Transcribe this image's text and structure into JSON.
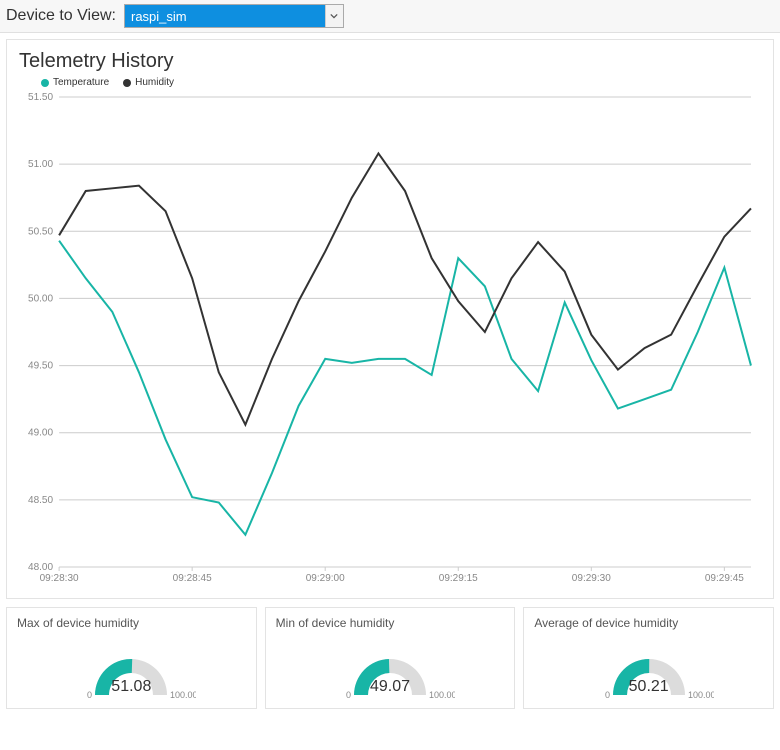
{
  "header": {
    "label": "Device to View:",
    "selected_device": "raspi_sim"
  },
  "chart_data": {
    "type": "line",
    "title": "Telemetry History",
    "xlabel": "",
    "ylabel": "",
    "ylim": [
      48.0,
      51.5
    ],
    "y_ticks": [
      48.0,
      48.5,
      49.0,
      49.5,
      50.0,
      50.5,
      51.0,
      51.5
    ],
    "x_ticks": [
      "09:28:30",
      "09:28:45",
      "09:29:00",
      "09:29:15",
      "09:29:30",
      "09:29:45"
    ],
    "categories_seconds": [
      30,
      33,
      36,
      39,
      42,
      45,
      48,
      51,
      54,
      57,
      60,
      63,
      66,
      69,
      72,
      75,
      78,
      81,
      84,
      87,
      90,
      93,
      96,
      99,
      102,
      105,
      108
    ],
    "series": [
      {
        "name": "Temperature",
        "color": "#18b5a6",
        "values": [
          50.43,
          50.15,
          49.9,
          49.45,
          48.95,
          48.52,
          48.48,
          48.24,
          48.7,
          49.2,
          49.55,
          49.52,
          49.55,
          49.55,
          49.43,
          50.3,
          50.09,
          49.55,
          49.31,
          49.97,
          49.54,
          49.18,
          49.25,
          49.32,
          49.75,
          50.23,
          49.5
        ]
      },
      {
        "name": "Humidity",
        "color": "#333333",
        "values": [
          50.47,
          50.8,
          50.82,
          50.84,
          50.65,
          50.15,
          49.45,
          49.06,
          49.55,
          49.98,
          50.35,
          50.75,
          51.08,
          50.8,
          50.3,
          49.98,
          49.75,
          50.15,
          50.42,
          50.2,
          49.73,
          49.47,
          49.63,
          49.73,
          50.1,
          50.46,
          50.67
        ]
      }
    ],
    "legend_position": "top-left"
  },
  "gauges": [
    {
      "title": "Max of device humidity",
      "value": 51.08,
      "min": 0,
      "max": 100.0
    },
    {
      "title": "Min of device humidity",
      "value": 49.07,
      "min": 0,
      "max": 100.0
    },
    {
      "title": "Average of device humidity",
      "value": 50.21,
      "min": 0,
      "max": 100.0
    }
  ],
  "colors": {
    "temperature": "#18b5a6",
    "humidity": "#333333",
    "select_highlight": "#0e8fe0",
    "gauge_fill": "#18b5a6",
    "gauge_track": "#dcdcdc"
  }
}
